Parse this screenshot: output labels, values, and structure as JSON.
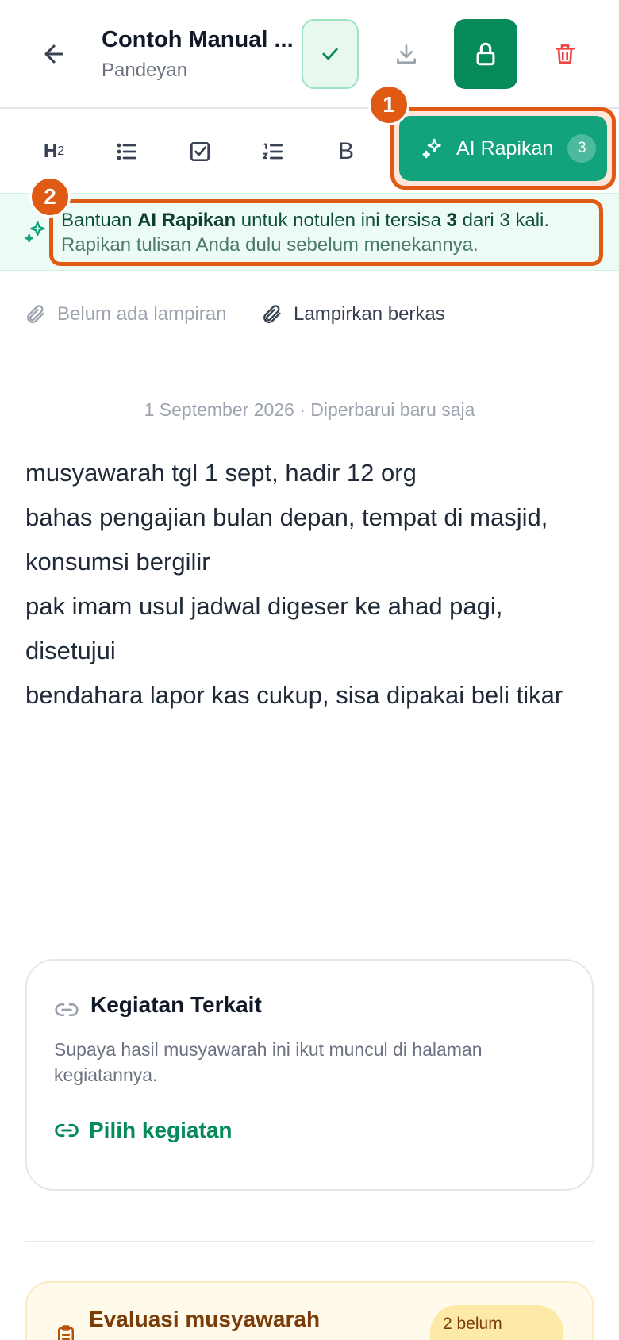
{
  "header": {
    "title": "Contoh Manual ...",
    "subtitle": "Pandeyan"
  },
  "toolbar": {
    "h2_label": "H",
    "h2_sub": "2",
    "bold_label": "B",
    "ai_label": "AI Rapikan",
    "ai_count": "3"
  },
  "markers": [
    "1",
    "2"
  ],
  "banner": {
    "prefix": "Bantuan ",
    "strong": "AI Rapikan",
    "mid": " untuk notulen ini tersisa ",
    "count": "3",
    "suffix": " dari 3 kali.",
    "line2": "Rapikan tulisan Anda dulu sebelum menekannya."
  },
  "attachments": {
    "none_label": "Belum ada lampiran",
    "add_label": "Lampirkan berkas"
  },
  "meta": "1 September 2026 · Diperbarui baru saja",
  "notes": [
    "musyawarah tgl 1 sept, hadir 12 org",
    "bahas pengajian bulan depan, tempat di masjid, konsumsi bergilir",
    "pak imam usul jadwal digeser ke ahad pagi, disetujui",
    "bendahara lapor kas cukup, sisa dipakai beli tikar"
  ],
  "related": {
    "title": "Kegiatan Terkait",
    "desc": "Supaya hasil musyawarah ini ikut muncul di halaman kegiatannya.",
    "action": "Pilih kegiatan"
  },
  "evaluation": {
    "title": "Evaluasi musyawarah",
    "badge": "2 belum"
  },
  "colors": {
    "brand": "#078a5a",
    "ai_button": "#12a37c",
    "highlight": "#e05a14",
    "danger": "#ef4444"
  }
}
